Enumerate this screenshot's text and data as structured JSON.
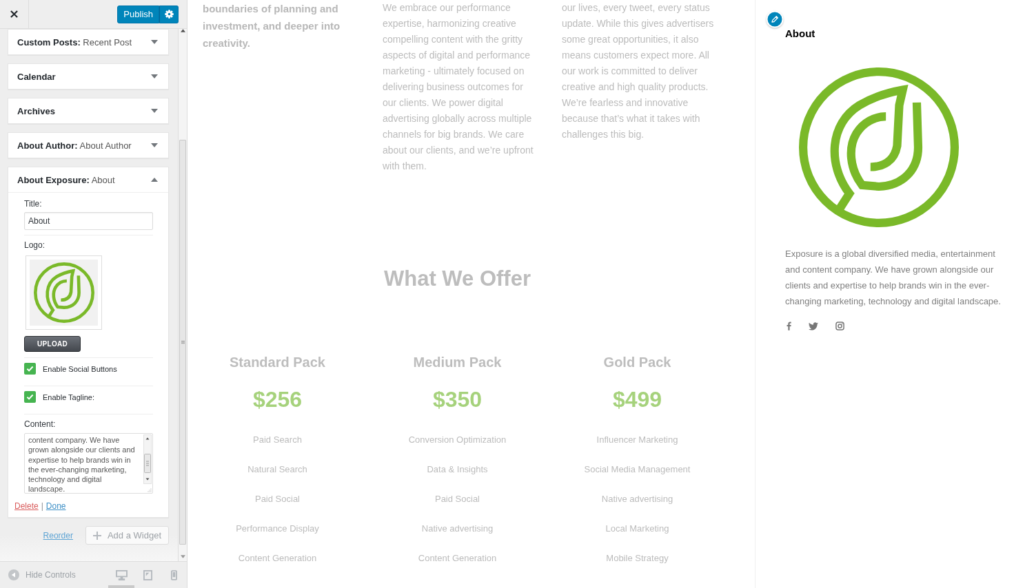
{
  "header": {
    "publish_button": "Publish"
  },
  "widgets": [
    {
      "title": "Custom Posts:",
      "instance": "Recent Post",
      "expanded": false
    },
    {
      "title": "Calendar",
      "expanded": false
    },
    {
      "title": "Archives",
      "expanded": false
    },
    {
      "title": "About Author:",
      "instance": "About Author",
      "expanded": false
    },
    {
      "title": "About Exposure:",
      "instance": "About",
      "expanded": true,
      "fields": [
        {
          "kind": "text",
          "label": "Title:",
          "value": "About"
        },
        {
          "kind": "image",
          "label": "Logo:",
          "button": "UPLOAD"
        },
        {
          "kind": "checkbox",
          "label": "Enable Social Buttons",
          "checked": true
        },
        {
          "kind": "checkbox",
          "label": "Enable Tagline:",
          "checked": true
        },
        {
          "kind": "textarea",
          "label": "Content:",
          "value": "content company. We have grown alongside our clients and expertise to help brands win in the ever-changing marketing, technology and digital landscape."
        }
      ],
      "actions": {
        "delete": "Delete",
        "separator": "|",
        "done": "Done"
      }
    }
  ],
  "widget_area_actions": {
    "reorder": "Reorder",
    "add_widget": "Add a Widget"
  },
  "footer": {
    "hide_controls": "Hide Controls",
    "devices": [
      {
        "kind": "desktop",
        "selected": true
      },
      {
        "kind": "tablet",
        "selected": false
      },
      {
        "kind": "mobile",
        "selected": false
      }
    ]
  },
  "preview": {
    "intro": {
      "lead": "boundaries of planning and investment, and deeper into creativity.",
      "columns": [
        "We embrace our performance expertise, harmonizing creative compelling content with the gritty aspects of digital and performance marketing - ultimately focused on delivering business outcomes for our clients. We power digital advertising globally across multiple channels for big brands. We care about our clients, and we’re upfront with them.",
        "our lives, every tweet, every status update. While this gives advertisers some great opportunities, it also means customers expect more. All our work is committed to deliver creative and high quality products. We’re fearless and innovative because that’s what it takes with challenges this big."
      ]
    },
    "offer": {
      "heading": "What We Offer",
      "packs": [
        {
          "name": "Standard Pack",
          "price": "$256",
          "features": [
            "Paid Search",
            "Natural Search",
            "Paid Social",
            "Performance Display",
            "Content Generation"
          ]
        },
        {
          "name": "Medium Pack",
          "price": "$350",
          "features": [
            "Conversion Optimization",
            "Data & Insights",
            "Paid Social",
            "Native advertising",
            "Content Generation"
          ]
        },
        {
          "name": "Gold Pack",
          "price": "$499",
          "features": [
            "Influencer Marketing",
            "Social Media Management",
            "Native advertising",
            "Local Marketing",
            "Mobile Strategy"
          ]
        }
      ]
    },
    "about_widget": {
      "title": "About",
      "text": "Exposure is a global diversified media, entertainment and content company. We have grown alongside our clients and expertise to help brands win in the ever-changing marketing, technology and digital landscape.",
      "social_links": [
        {
          "kind": "facebook"
        },
        {
          "kind": "twitter"
        },
        {
          "kind": "instagram"
        }
      ]
    }
  }
}
